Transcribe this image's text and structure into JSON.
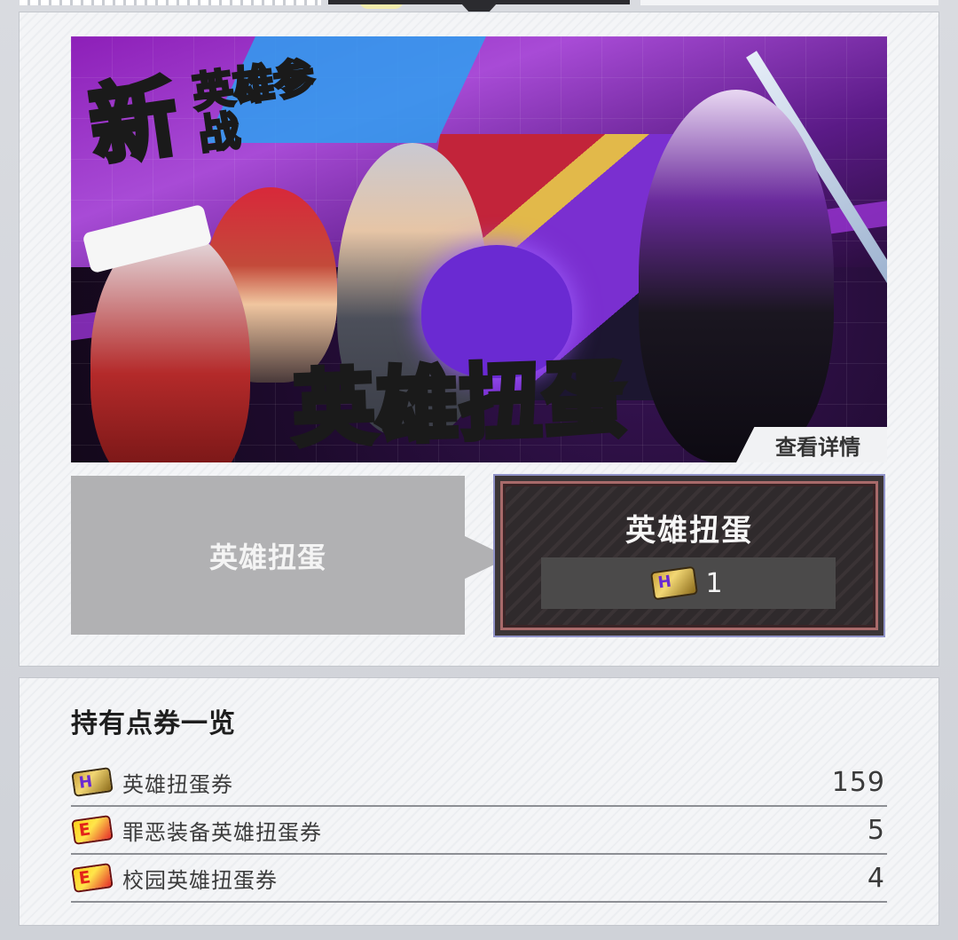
{
  "banner": {
    "badge_main": "新",
    "badge_sub": "英雄参战",
    "title": "英雄扭蛋",
    "detail_button": "查看详情"
  },
  "tabs": [
    {
      "label": "英雄扭蛋",
      "selected": false
    },
    {
      "label": "英雄扭蛋",
      "selected": true,
      "cost_icon": "hero-ticket-icon",
      "cost": "1"
    }
  ],
  "ticket_list": {
    "title": "持有点券一览",
    "items": [
      {
        "icon": "hero-ticket-icon",
        "name": "英雄扭蛋券",
        "count": "159"
      },
      {
        "icon": "event-ticket-icon",
        "name": "罪恶装备英雄扭蛋券",
        "count": "5"
      },
      {
        "icon": "event-ticket-icon",
        "name": "校园英雄扭蛋券",
        "count": "4"
      }
    ]
  },
  "colors": {
    "accent_yellow": "#ffe23a",
    "selected_border": "#8f92c7",
    "inactive_tab": "#b1b1b3"
  }
}
